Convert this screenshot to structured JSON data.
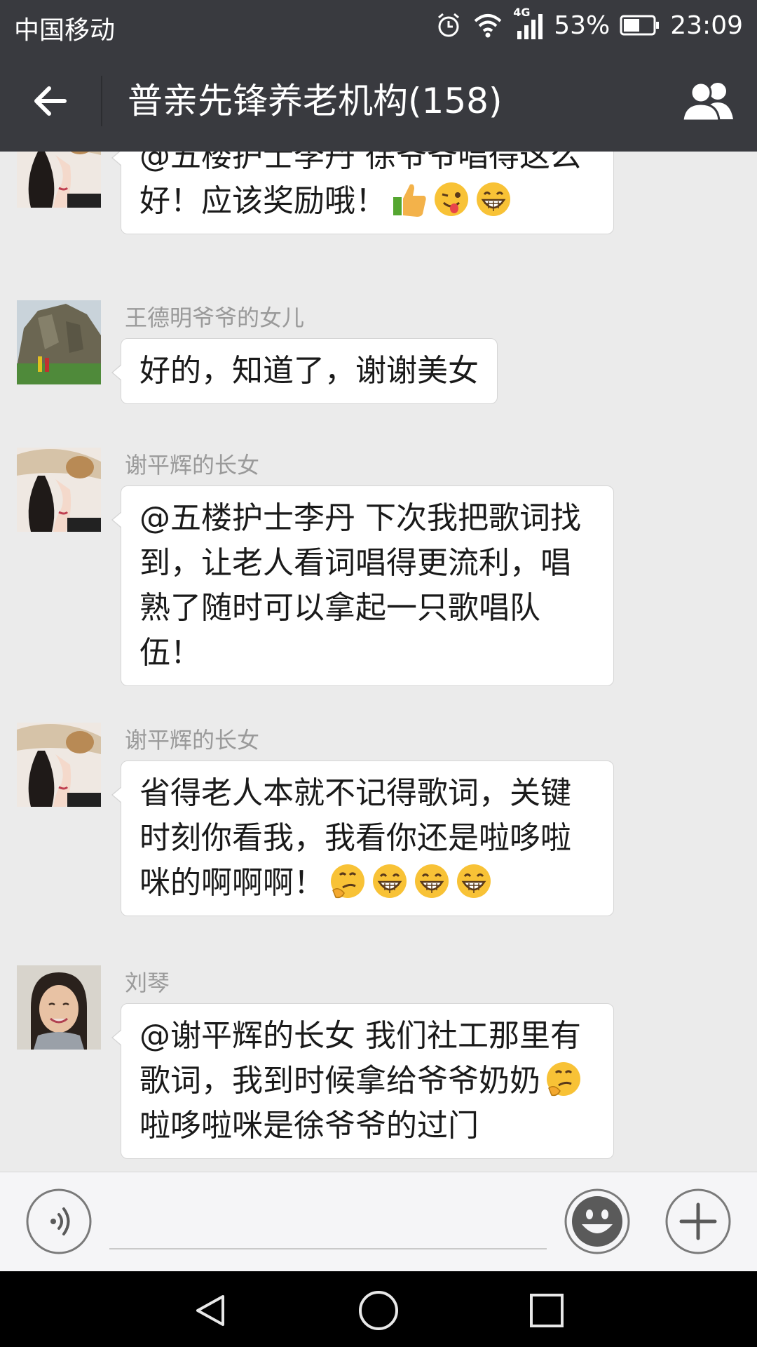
{
  "status_bar": {
    "carrier": "中国移动",
    "network": "4G",
    "battery_percent": "53%",
    "time": "23:09"
  },
  "header": {
    "title": "普亲先锋养老机构(158)"
  },
  "messages": [
    {
      "sender": "",
      "avatar": "woman-in-sunhat-avatar",
      "text": "@五楼护士李丹 徐爷爷唱得这么好！应该奖励哦！",
      "emojis": [
        "thumbs-up-emoji",
        "winking-tongue-emoji",
        "grinning-emoji"
      ]
    },
    {
      "sender": "王德明爷爷的女儿",
      "avatar": "cliff-landscape-avatar",
      "text": "好的，知道了，谢谢美女",
      "emojis": []
    },
    {
      "sender": "谢平辉的长女",
      "avatar": "woman-in-sunhat-avatar",
      "text": "@五楼护士李丹 下次我把歌词找到，让老人看词唱得更流利，唱熟了随时可以拿起一只歌唱队伍！",
      "emojis": []
    },
    {
      "sender": "谢平辉的长女",
      "avatar": "woman-in-sunhat-avatar",
      "text": "省得老人本就不记得歌词，关键时刻你看我，我看你还是啦哆啦咪的啊啊啊！",
      "emojis": [
        "thinking-emoji",
        "grinning-emoji",
        "grinning-emoji",
        "grinning-emoji"
      ]
    },
    {
      "sender": "刘琴",
      "avatar": "smiling-woman-avatar",
      "text_before_emoji": "@谢平辉的长女 我们社工那里有歌词，我到时候拿给爷爷奶奶",
      "inline_emoji": "thinking-emoji",
      "text_after_emoji": "啦哆啦咪是徐爷爷的过门"
    }
  ],
  "input_bar": {
    "voice_icon": "voice-icon",
    "emoji_icon": "smiley-icon",
    "plus_icon": "plus-icon",
    "input_value": ""
  },
  "colors": {
    "titlebar_bg": "#393a3f",
    "chat_bg": "#ebebeb",
    "bubble_bg": "#ffffff",
    "sender_text": "#9a9a9a"
  }
}
